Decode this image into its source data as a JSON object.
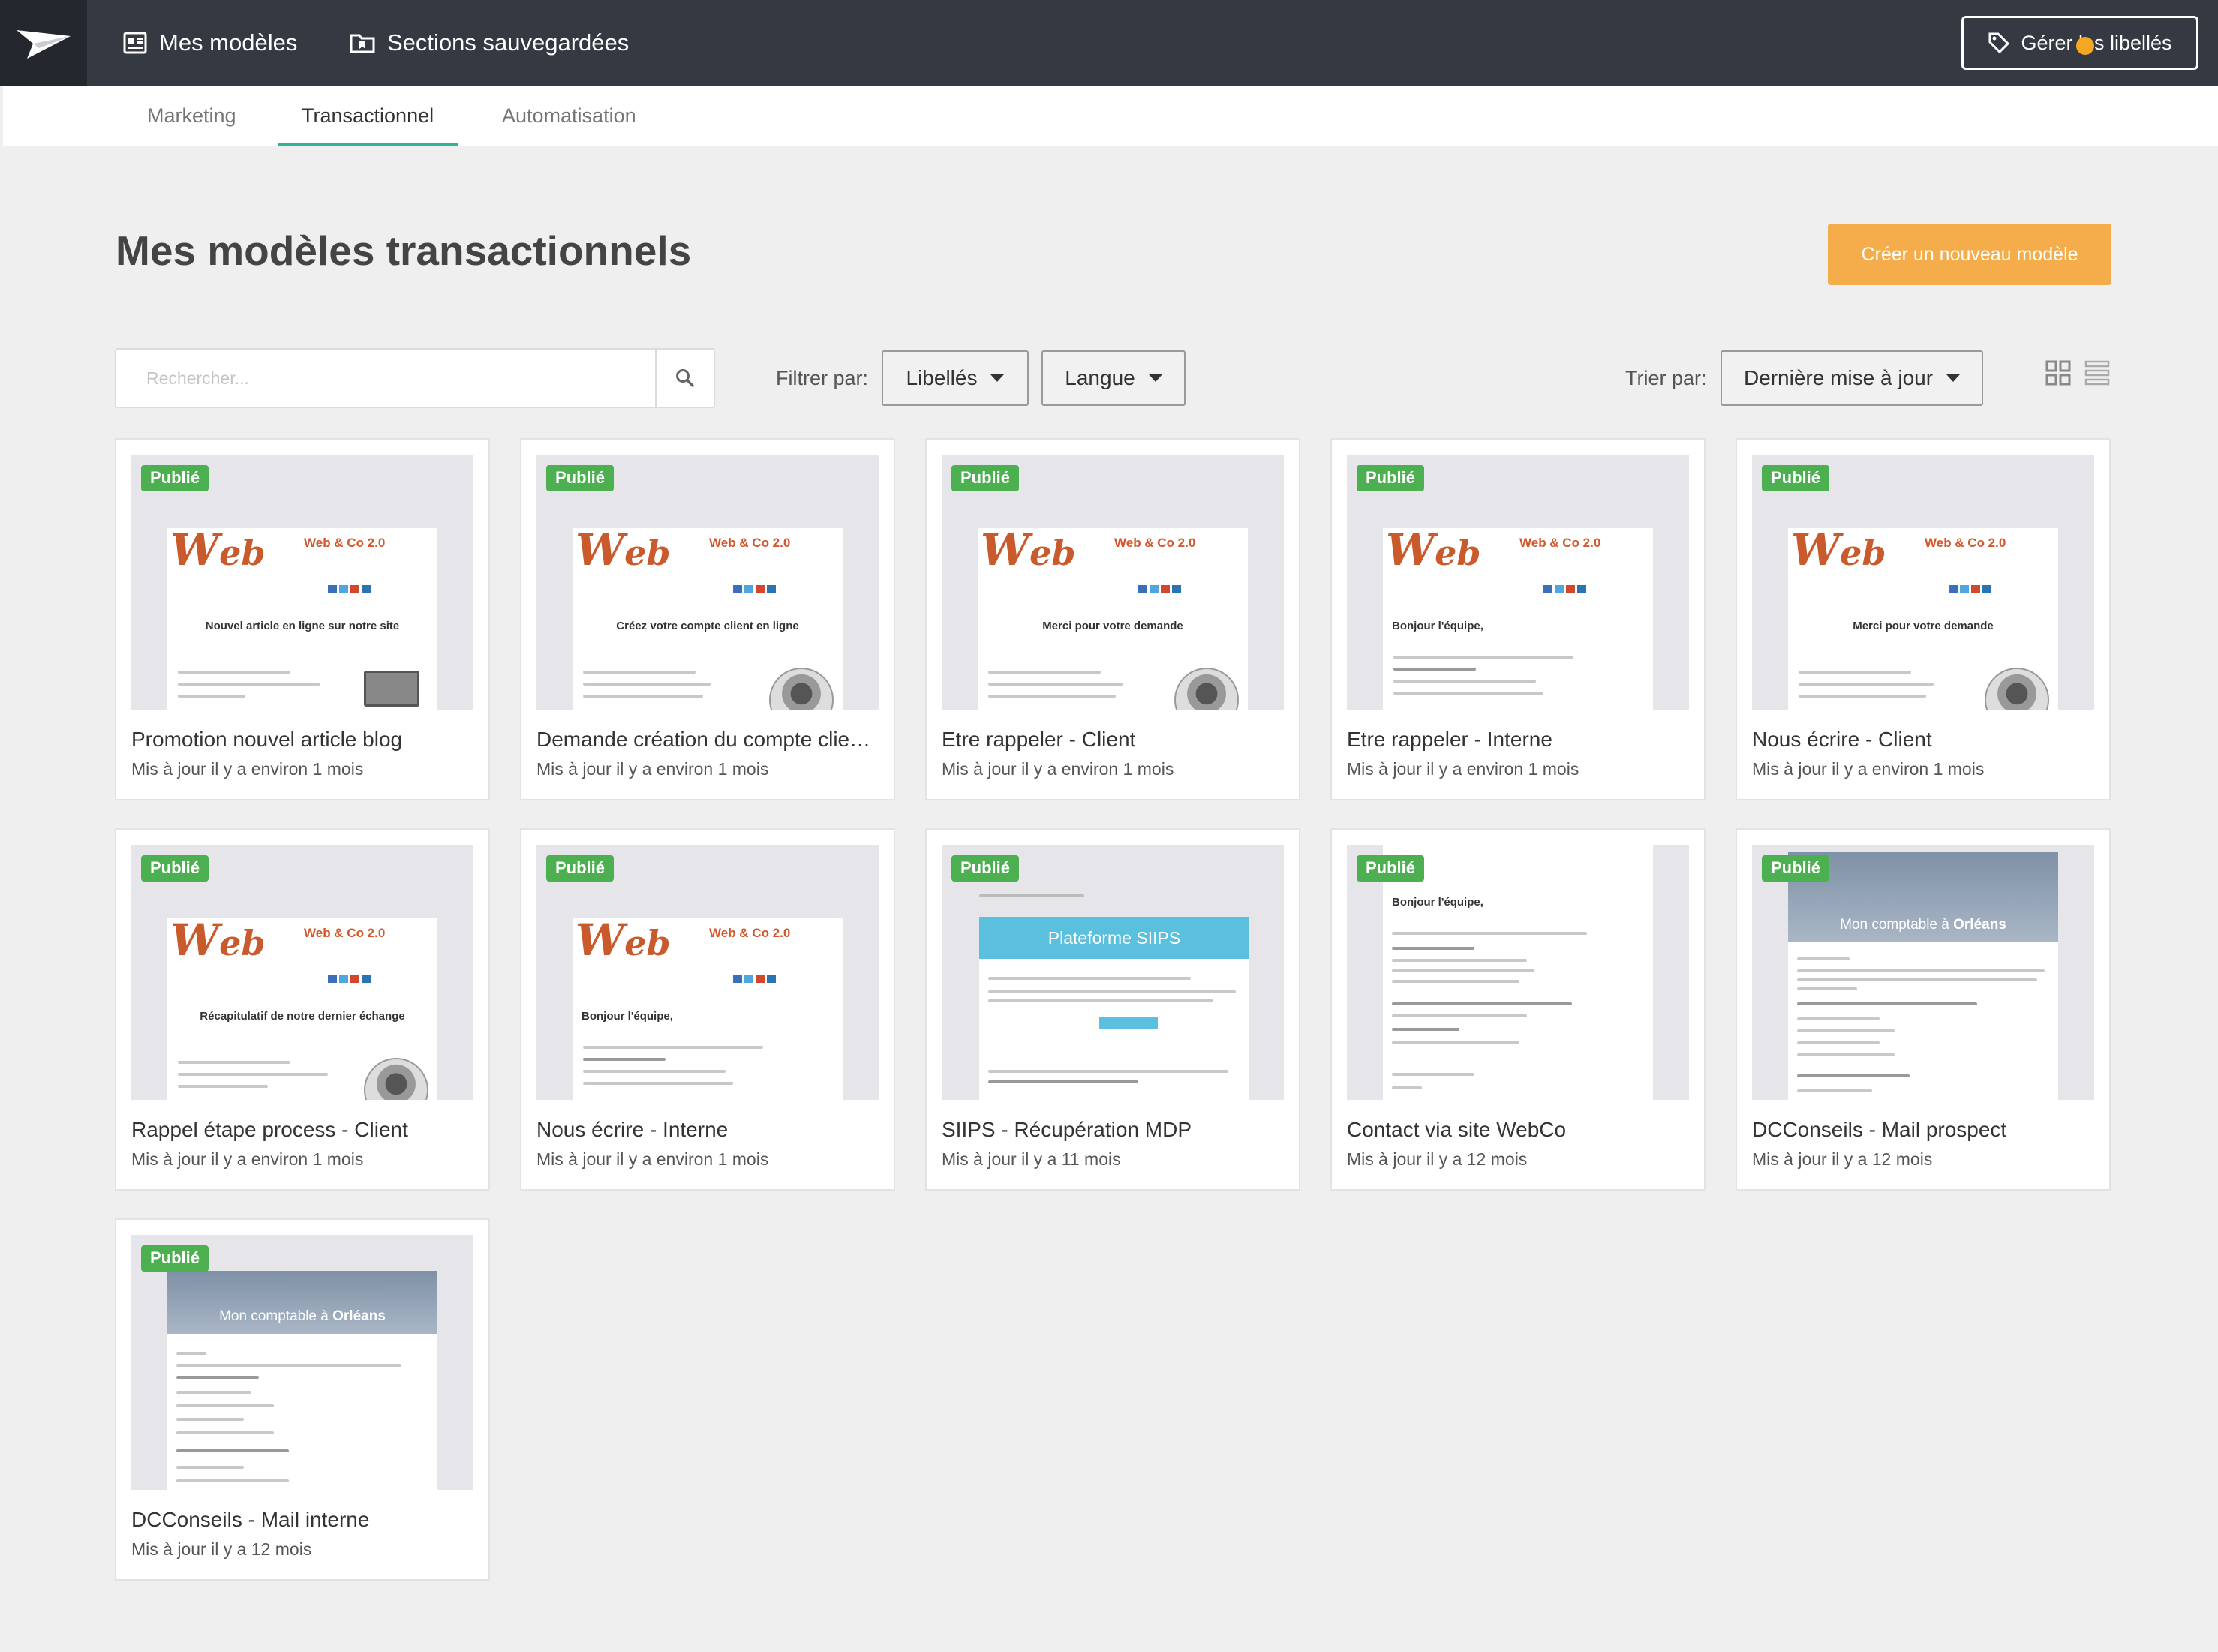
{
  "topbar": {
    "nav": [
      {
        "label": "Mes modèles",
        "icon": "templates-icon"
      },
      {
        "label": "Sections sauvegardées",
        "icon": "saved-folder-icon"
      }
    ],
    "manage_labels": "Gérer les libellés"
  },
  "tabs": [
    {
      "label": "Marketing",
      "active": false
    },
    {
      "label": "Transactionnel",
      "active": true
    },
    {
      "label": "Automatisation",
      "active": false
    }
  ],
  "page": {
    "title": "Mes modèles transactionnels",
    "create_button": "Créer un nouveau modèle"
  },
  "toolbar": {
    "search_placeholder": "Rechercher...",
    "filter_label": "Filtrer par:",
    "filter_tags": "Libellés",
    "filter_language": "Langue",
    "sort_label": "Trier par:",
    "sort_value": "Dernière mise à jour"
  },
  "colors": {
    "topbar": "#353a42",
    "accent_tab": "#35b296",
    "create_button": "#f4ad4a",
    "badge": "#4caf50"
  },
  "templates": [
    {
      "title": "Promotion nouvel article blog",
      "updated": "Mis à jour il y a environ 1 mois",
      "status": "Publié",
      "thumb": {
        "heading": "Nouvel article en ligne sur notre site",
        "brand": "Web & Co 2.0"
      }
    },
    {
      "title": "Demande création du compte client en ligne",
      "updated": "Mis à jour il y a environ 1 mois",
      "status": "Publié",
      "thumb": {
        "heading": "Créez votre compte client en ligne",
        "brand": "Web & Co 2.0"
      }
    },
    {
      "title": "Etre rappeler - Client",
      "updated": "Mis à jour il y a environ 1 mois",
      "status": "Publié",
      "thumb": {
        "heading": "Merci pour votre demande",
        "brand": "Web & Co 2.0"
      }
    },
    {
      "title": "Etre rappeler - Interne",
      "updated": "Mis à jour il y a environ 1 mois",
      "status": "Publié",
      "thumb": {
        "heading": "Bonjour l'équipe,",
        "brand": "Web & Co 2.0"
      }
    },
    {
      "title": "Nous écrire - Client",
      "updated": "Mis à jour il y a environ 1 mois",
      "status": "Publié",
      "thumb": {
        "heading": "Merci pour votre demande",
        "brand": "Web & Co 2.0"
      }
    },
    {
      "title": "Rappel étape process - Client",
      "updated": "Mis à jour il y a environ 1 mois",
      "status": "Publié",
      "thumb": {
        "heading": "Récapitulatif de notre dernier échange",
        "brand": "Web & Co 2.0"
      }
    },
    {
      "title": "Nous écrire - Interne",
      "updated": "Mis à jour il y a environ 1 mois",
      "status": "Publié",
      "thumb": {
        "heading": "Bonjour l'équipe,",
        "brand": "Web & Co 2.0"
      }
    },
    {
      "title": "SIIPS - Récupération MDP",
      "updated": "Mis à jour il y a 11 mois",
      "status": "Publié",
      "thumb": {
        "banner": "Plateforme SIIPS"
      }
    },
    {
      "title": "Contact via site WebCo",
      "updated": "Mis à jour il y a 12 mois",
      "status": "Publié",
      "thumb": {
        "heading": "Bonjour l'équipe,"
      }
    },
    {
      "title": "DCConseils - Mail prospect",
      "updated": "Mis à jour il y a 12 mois",
      "status": "Publié",
      "thumb": {
        "banner_plain": "Mon comptable à ",
        "banner_bold": "Orléans"
      }
    },
    {
      "title": "DCConseils - Mail interne",
      "updated": "Mis à jour il y a 12 mois",
      "status": "Publié",
      "thumb": {
        "banner_plain": "Mon comptable à ",
        "banner_bold": "Orléans"
      }
    }
  ]
}
